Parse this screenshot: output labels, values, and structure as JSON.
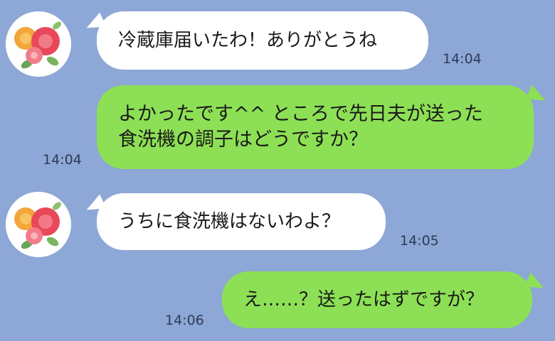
{
  "messages": [
    {
      "side": "in",
      "text": "冷蔵庫届いたわ！ありがとうね",
      "time": "14:04"
    },
    {
      "side": "out",
      "text": "よかったです^^ ところで先日夫が送った\n食洗機の調子はどうですか？",
      "time": "14:04"
    },
    {
      "side": "in",
      "text": "うちに食洗機はないわよ？",
      "time": "14:05"
    },
    {
      "side": "out",
      "text": "え……？送ったはずですが？",
      "time": "14:06"
    }
  ],
  "colors": {
    "background": "#8da7d6",
    "incoming": "#ffffff",
    "outgoing": "#8de055"
  },
  "icons": {
    "avatar": "rose-bouquet-icon"
  }
}
